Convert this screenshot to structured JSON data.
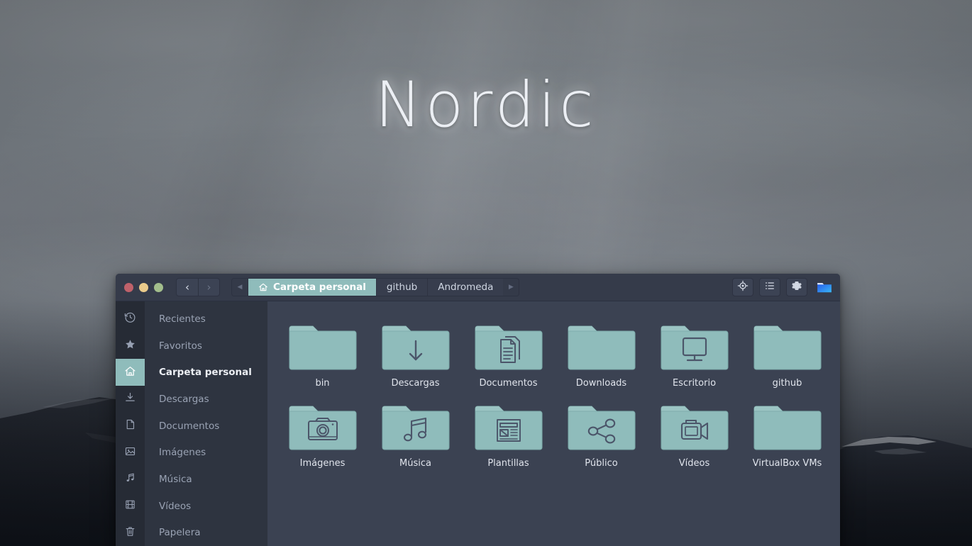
{
  "desktop": {
    "wallpaper_wordmark": "Nordic",
    "colors": {
      "accent_teal": "#8fbcbb",
      "window_bg": "#3b4252",
      "sidebar_bg": "#2e3440",
      "rail_bg": "#262b35",
      "headerbar_bg": "#353b4a",
      "close": "#bf616a",
      "minimize": "#ebcb8b",
      "maximize": "#a3be8c",
      "folder_fill": "#8fbcbb",
      "folder_stroke": "#4c566a",
      "app_icon_blue": "#2f7ef7"
    }
  },
  "window": {
    "controls": [
      {
        "name": "close",
        "icon": "close-circle-icon"
      },
      {
        "name": "minimize",
        "icon": "minimize-circle-icon"
      },
      {
        "name": "maximize",
        "icon": "maximize-circle-icon"
      }
    ],
    "nav": {
      "back_glyph": "‹",
      "forward_glyph": "›",
      "back_enabled": true,
      "forward_enabled": false
    },
    "breadcrumb": {
      "scroll_left_glyph": "◀",
      "scroll_right_glyph": "▶",
      "items": [
        {
          "label": "Carpeta personal",
          "icon": "home-icon",
          "active": true
        },
        {
          "label": "github",
          "icon": "",
          "active": false
        },
        {
          "label": "Andromeda",
          "icon": "",
          "active": false
        }
      ]
    },
    "toolbar": [
      {
        "name": "location-target-button",
        "icon": "location-target-icon"
      },
      {
        "name": "view-list-button",
        "icon": "list-view-icon"
      },
      {
        "name": "settings-button",
        "icon": "gear-icon"
      }
    ],
    "app_icon": {
      "name": "file-manager-app-icon",
      "icon": "blue-folder-icon"
    }
  },
  "sidebar": {
    "items": [
      {
        "label": "Recientes",
        "icon": "clock-history-icon",
        "active": false
      },
      {
        "label": "Favoritos",
        "icon": "star-icon",
        "active": false
      },
      {
        "label": "Carpeta personal",
        "icon": "home-icon",
        "active": true
      },
      {
        "label": "Descargas",
        "icon": "download-icon",
        "active": false
      },
      {
        "label": "Documentos",
        "icon": "document-icon",
        "active": false
      },
      {
        "label": "Imágenes",
        "icon": "image-icon",
        "active": false
      },
      {
        "label": "Música",
        "icon": "music-note-icon",
        "active": false
      },
      {
        "label": "Vídeos",
        "icon": "film-icon",
        "active": false
      },
      {
        "label": "Papelera",
        "icon": "trash-icon",
        "active": false
      }
    ]
  },
  "content": {
    "files": [
      {
        "label": "bin",
        "icon": "folder-plain-icon"
      },
      {
        "label": "Descargas",
        "icon": "folder-download-icon"
      },
      {
        "label": "Documentos",
        "icon": "folder-documents-icon"
      },
      {
        "label": "Downloads",
        "icon": "folder-plain-icon"
      },
      {
        "label": "Escritorio",
        "icon": "folder-desktop-icon"
      },
      {
        "label": "github",
        "icon": "folder-plain-icon"
      },
      {
        "label": "Imágenes",
        "icon": "folder-pictures-icon"
      },
      {
        "label": "Música",
        "icon": "folder-music-icon"
      },
      {
        "label": "Plantillas",
        "icon": "folder-templates-icon"
      },
      {
        "label": "Público",
        "icon": "folder-public-icon"
      },
      {
        "label": "Vídeos",
        "icon": "folder-videos-icon"
      },
      {
        "label": "VirtualBox VMs",
        "icon": "folder-plain-icon"
      }
    ]
  }
}
